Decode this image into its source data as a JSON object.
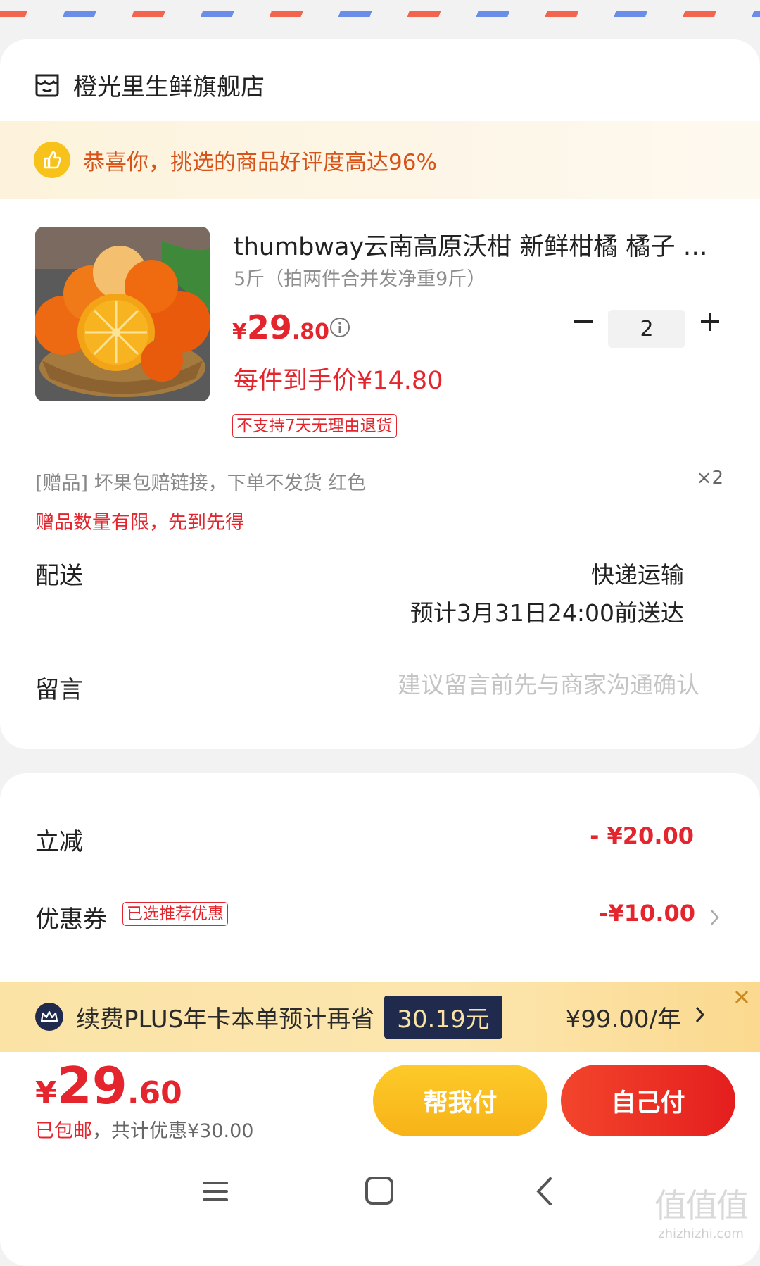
{
  "shop": {
    "name": "橙光里生鲜旗舰店"
  },
  "praise": {
    "text": "恭喜你，挑选的商品好评度高达96%"
  },
  "product": {
    "title": "thumbway云南高原沃柑 新鲜柑橘 橘子 …",
    "spec": "5斤（拍两件合并发净重9斤）",
    "price_symbol": "¥",
    "price_int": "29",
    "price_dec": ".80",
    "each_price": "每件到手价¥14.80",
    "return_tag": "不支持7天无理由退货",
    "quantity": "2"
  },
  "gift": {
    "text": "[赠品]  坏果包赔链接，下单不发货 红色",
    "qty": "×2",
    "limit": "赠品数量有限，先到先得"
  },
  "shipping": {
    "label": "配送",
    "method": "快递运输",
    "eta": "预计3月31日24:00前送达"
  },
  "message": {
    "label": "留言",
    "placeholder": "建议留言前先与商家沟通确认"
  },
  "discounts": {
    "instant_label": "立减",
    "instant_value": "- ¥20.00",
    "coupon_label": "优惠券",
    "coupon_tag": "已选推荐优惠",
    "coupon_value": "-¥10.00"
  },
  "plus_banner": {
    "text": "续费PLUS年卡本单预计再省",
    "save": "30.19元",
    "price": "¥99.00/年"
  },
  "footer": {
    "total_symbol": "¥",
    "total_int": "29",
    "total_dec": ".60",
    "free_shipping": "已包邮",
    "discount_note": "，共计优惠¥30.00",
    "help_pay": "帮我付",
    "self_pay": "自己付"
  },
  "watermark": {
    "big": "值值值",
    "small": "zhizhizhi.com"
  },
  "colors": {
    "accent_red": "#e4252d",
    "gold": "#f7b318",
    "plus_navy": "#1f2a4d"
  },
  "icons": [
    "shop-icon",
    "thumbs-up-icon",
    "info-icon",
    "minus-icon",
    "plus-icon",
    "chevron-right-icon",
    "crown-icon",
    "close-icon",
    "menu-icon",
    "home-icon",
    "back-icon"
  ]
}
